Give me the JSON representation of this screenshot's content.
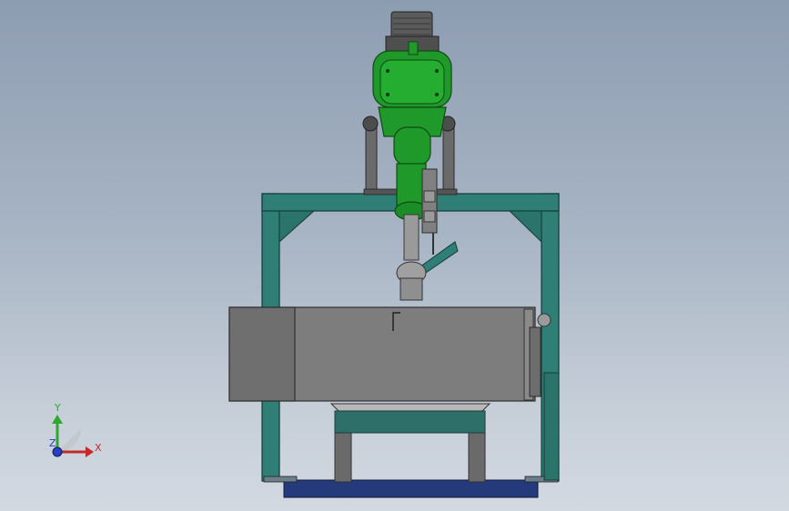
{
  "viewport": {
    "background_top": "#8d9db1",
    "background_bottom": "#d3d9e1"
  },
  "colors": {
    "frame_teal": "#2f7f76",
    "frame_dark": "#1f5a53",
    "motor_green": "#1f9a2a",
    "motor_dark": "#156b1c",
    "tank_gray": "#7d7d7d",
    "tank_dark": "#5c5c5c",
    "base_blue": "#243a7a",
    "shaft_gray": "#9a9a9a"
  },
  "triad": {
    "y_label": "Y",
    "x_label": "X",
    "z_label": "Z",
    "y_color": "#2fa82f",
    "x_color": "#c42a2a",
    "z_color": "#2a3fbf"
  }
}
